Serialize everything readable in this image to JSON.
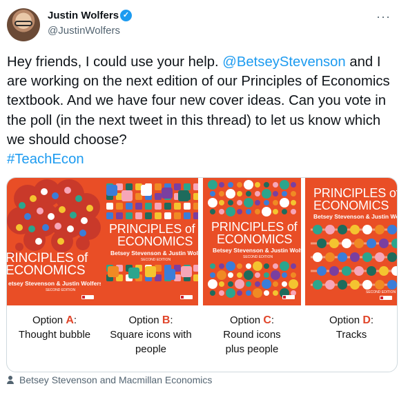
{
  "author": {
    "name": "Justin Wolfers",
    "handle": "@JustinWolfers",
    "verified_icon": "verified-badge-icon",
    "more_icon": "more-options-icon"
  },
  "tweet": {
    "text_1": "Hey friends, I could use your help. ",
    "mention": "@BetseyStevenson",
    "text_2": " and I are working on the next edition of our Principles of Economics textbook. And we have four new cover ideas. Can you vote in the poll (in the next tweet in this thread) to let us know which we should choose?",
    "hashtag": "#TeachEcon"
  },
  "covers": {
    "title_line1": "PRINCIPLES of",
    "title_line2": "ECONOMICS",
    "authors": "Betsey Stevenson & Justin Wolfers",
    "edition": "SECOND EDITION",
    "cover1_title_line1": "RINCIPLES of",
    "cover1_authors": "etsey Stevenson & Justin Wolfers",
    "cover4_title_line1": "PRINCIPLES of",
    "brand_color": "#e94e26",
    "options": [
      {
        "prefix": "Option ",
        "letter": "A",
        "suffix": ":",
        "desc_1": "Thought bubble",
        "desc_2": ""
      },
      {
        "prefix": "Option ",
        "letter": "B",
        "suffix": ":",
        "desc_1": "Square icons with",
        "desc_2": "people"
      },
      {
        "prefix": "Option ",
        "letter": "C",
        "suffix": ":",
        "desc_1": "Round icons",
        "desc_2": "plus people"
      },
      {
        "prefix": "Option ",
        "letter": "D",
        "suffix": ":",
        "desc_1": "Tracks",
        "desc_2": ""
      }
    ]
  },
  "tagged": {
    "icon": "person-icon",
    "text": "Betsey Stevenson and Macmillan Economics"
  }
}
